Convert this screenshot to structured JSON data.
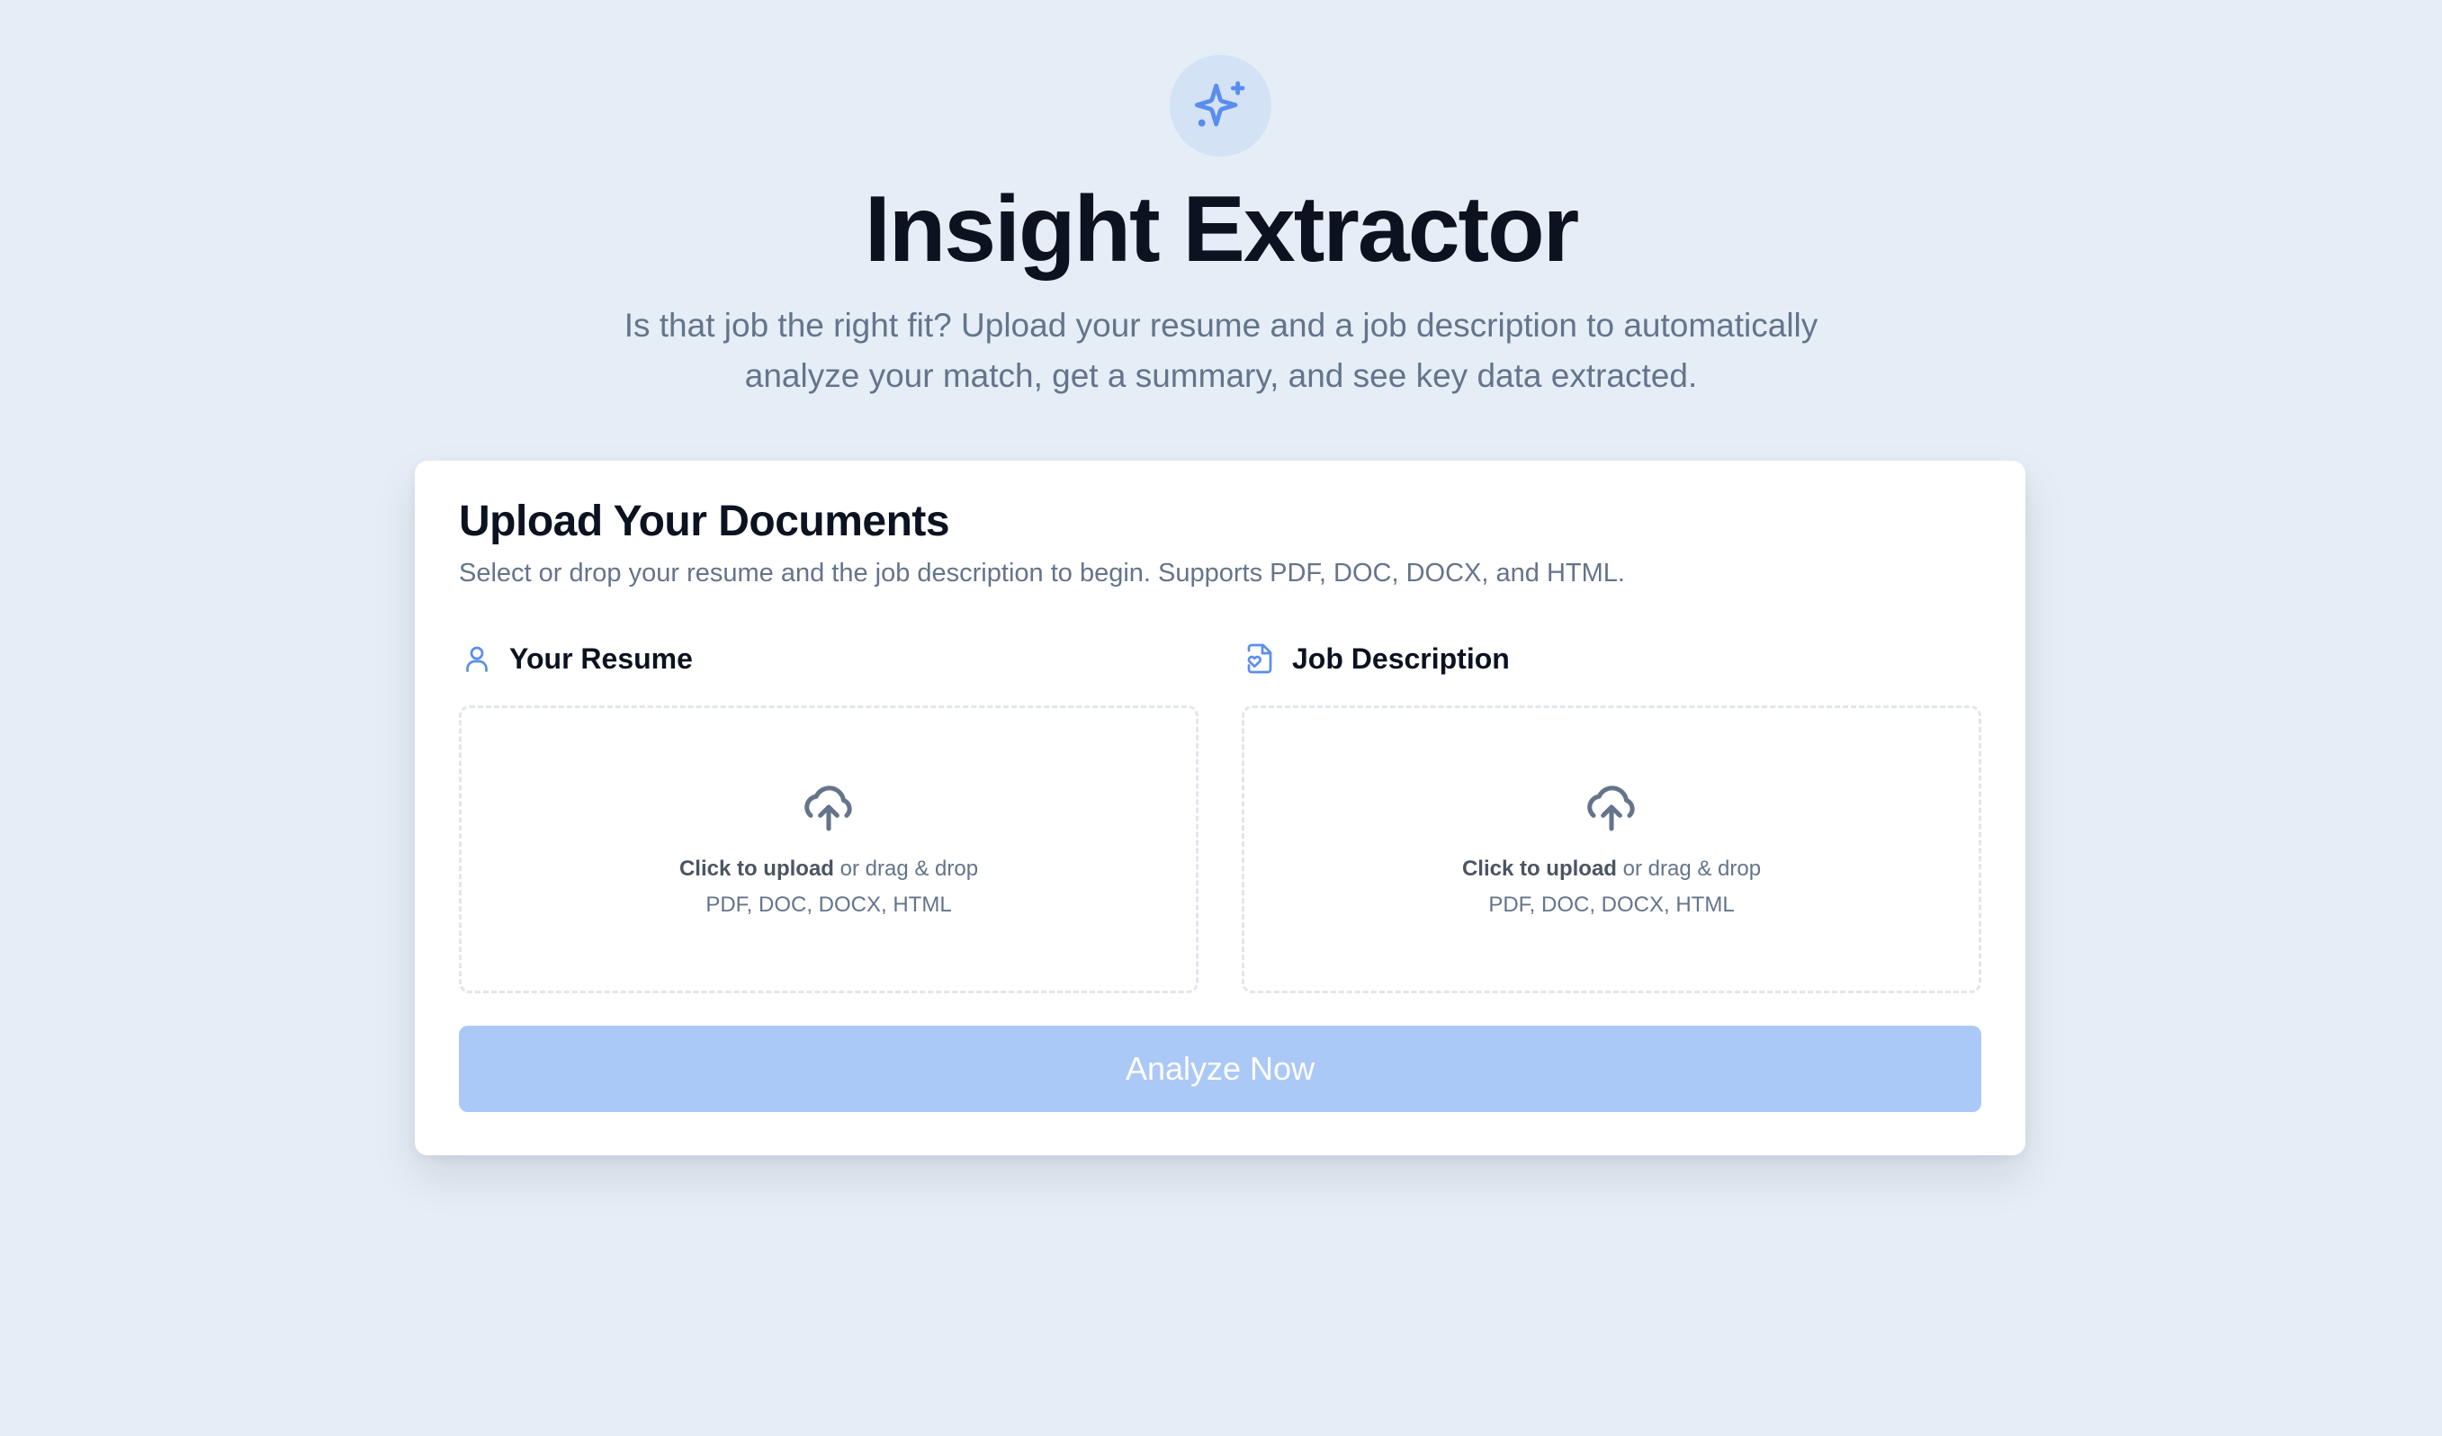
{
  "colors": {
    "page_background": "#e5edf6",
    "accent": "#5b8def",
    "button_disabled": "#abc9f7",
    "muted_text": "#64748b"
  },
  "header": {
    "icon": "sparkles-icon",
    "title": "Insight Extractor",
    "subtitle": "Is that job the right fit? Upload your resume and a job description to automatically analyze your match, get a summary, and see key data extracted."
  },
  "card": {
    "title": "Upload Your Documents",
    "description": "Select or drop your resume and the job description to begin. Supports PDF, DOC, DOCX, and HTML.",
    "resume": {
      "icon": "user-icon",
      "label": "Your Resume",
      "click_text": "Click to upload",
      "drag_text": " or drag & drop",
      "formats": "PDF, DOC, DOCX, HTML"
    },
    "job": {
      "icon": "file-heart-icon",
      "label": "Job Description",
      "click_text": "Click to upload",
      "drag_text": " or drag & drop",
      "formats": "PDF, DOC, DOCX, HTML"
    },
    "analyze_label": "Analyze Now"
  }
}
